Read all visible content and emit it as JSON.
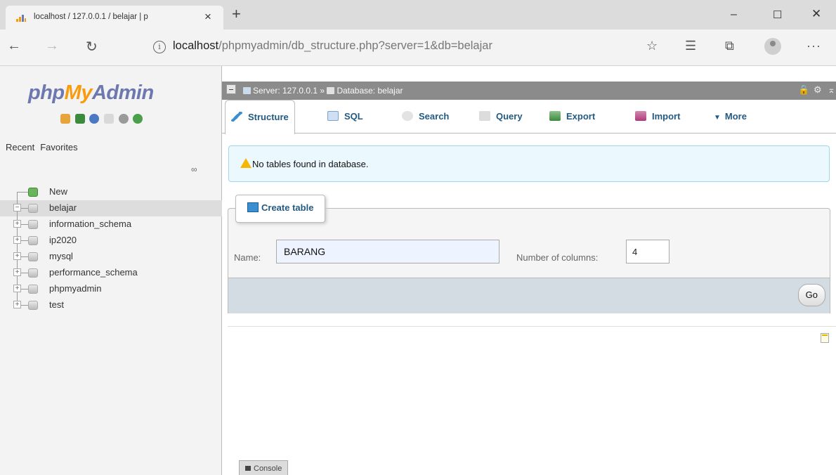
{
  "browser": {
    "tab_title": "localhost / 127.0.0.1 / belajar | p",
    "url_host": "localhost",
    "url_path": "/phpmyadmin/db_structure.php?server=1&db=belajar"
  },
  "nav": {
    "logo_php": "php",
    "logo_my": "My",
    "logo_admin": "Admin",
    "recent_label": "Recent",
    "favorites_label": "Favorites",
    "tree": [
      {
        "label": "New",
        "selected": false
      },
      {
        "label": "belajar",
        "selected": true
      },
      {
        "label": "information_schema",
        "selected": false
      },
      {
        "label": "ip2020",
        "selected": false
      },
      {
        "label": "mysql",
        "selected": false
      },
      {
        "label": "performance_schema",
        "selected": false
      },
      {
        "label": "phpmyadmin",
        "selected": false
      },
      {
        "label": "test",
        "selected": false
      }
    ]
  },
  "breadcrumb": {
    "server": "Server: 127.0.0.1",
    "separator": "»",
    "database": "Database: belajar"
  },
  "tabs": [
    {
      "label": "Structure",
      "icon": "structure-icon",
      "active": true
    },
    {
      "label": "SQL",
      "icon": "sql-icon"
    },
    {
      "label": "Search",
      "icon": "search-icon"
    },
    {
      "label": "Query",
      "icon": "query-icon"
    },
    {
      "label": "Export",
      "icon": "export-icon"
    },
    {
      "label": "Import",
      "icon": "import-icon"
    },
    {
      "label": "More",
      "icon": "chevron-down-icon"
    }
  ],
  "notice": {
    "text": "No tables found in database."
  },
  "create_table": {
    "legend": "Create table",
    "name_label": "Name:",
    "name_value": "BARANG",
    "columns_label": "Number of columns:",
    "columns_value": "4",
    "go_label": "Go"
  },
  "console": {
    "label": "Console"
  },
  "colors": {
    "logo_blue": "#6c78af",
    "logo_orange": "#f89c0e",
    "link_blue": "#235a81",
    "notice_bg": "#ebf8fd",
    "server_bar": "#8b8b8b"
  }
}
